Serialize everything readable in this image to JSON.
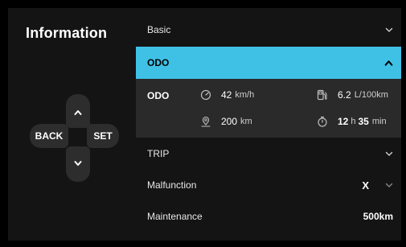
{
  "left": {
    "title": "Information",
    "dpad": {
      "back_label": "BACK",
      "set_label": "SET"
    }
  },
  "sections": {
    "basic": {
      "label": "Basic"
    },
    "odo": {
      "header_label": "ODO",
      "row_label": "ODO",
      "speed": {
        "value": "42",
        "unit": "km/h",
        "icon": "speedometer-icon"
      },
      "fuel": {
        "value": "6.2",
        "unit": "L/100km",
        "icon": "fuel-pump-icon"
      },
      "distance": {
        "value": "200",
        "unit": "km",
        "icon": "location-pin-icon"
      },
      "time": {
        "hours": "12",
        "hours_unit": "h",
        "minutes": "35",
        "minutes_unit": "min",
        "icon": "stopwatch-icon"
      }
    },
    "trip": {
      "label": "TRIP"
    },
    "malfunction": {
      "label": "Malfunction",
      "value": "X"
    },
    "maintenance": {
      "label": "Maintenance",
      "value": "500km"
    }
  },
  "colors": {
    "accent": "#3fc1e6",
    "background": "#141414",
    "detail_bg": "#2a2a2a",
    "button_bg": "#2d2d2d"
  }
}
